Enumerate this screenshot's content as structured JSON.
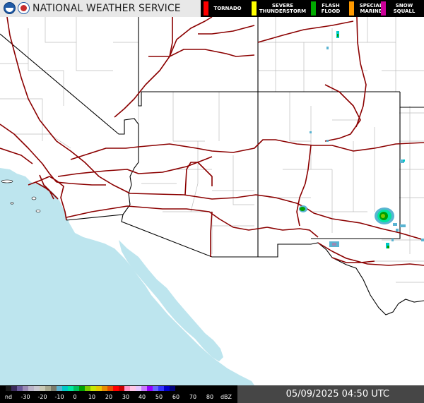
{
  "header": {
    "agency": "NATIONAL WEATHER SERVICE",
    "logo_left": "noaa-logo",
    "logo_right": "nws-logo"
  },
  "legend": [
    {
      "label": "TORNADO",
      "color": "#ff0000"
    },
    {
      "label": "SEVERE THUNDERSTORM",
      "color": "#ffff00"
    },
    {
      "label": "FLASH FLOOD",
      "color": "#00aa00"
    },
    {
      "label": "SPECIAL MARINE",
      "color": "#ff9900"
    },
    {
      "label": "SNOW SQUALL",
      "color": "#cc0099"
    }
  ],
  "footer": {
    "units_no_data": "nd",
    "units_label": "dBZ",
    "scale_ticks": [
      "-30",
      "-20",
      "-10",
      "0",
      "10",
      "20",
      "30",
      "40",
      "50",
      "60",
      "70",
      "80"
    ],
    "timestamp": "05/09/2025 04:50 UTC"
  },
  "colors": {
    "ocean": "#bde5ee",
    "land": "#ffffff",
    "highway": "#8b0000",
    "county_border": "#bdbdbd",
    "state_border": "#000000",
    "header_bg": "#e8e8e8",
    "legend_bg": "#000000"
  },
  "dbz_scale_colors": [
    "#000000",
    "#1a1a1a",
    "#3a2a5a",
    "#6a5a9a",
    "#9a8ab4",
    "#bab4c8",
    "#c8c8d0",
    "#c8c8b4",
    "#a8a890",
    "#7c7c6c",
    "#5ab4d2",
    "#00c8c8",
    "#00e6a0",
    "#00c060",
    "#00a000",
    "#7cc800",
    "#c8e600",
    "#e6c800",
    "#e68c00",
    "#e65000",
    "#ff0000",
    "#c80000",
    "#ff96c8",
    "#ffc8e6",
    "#e6c8ff",
    "#c878ff",
    "#9600ff",
    "#6464ff",
    "#3232ff",
    "#0000c8",
    "#000078",
    "#000000"
  ]
}
